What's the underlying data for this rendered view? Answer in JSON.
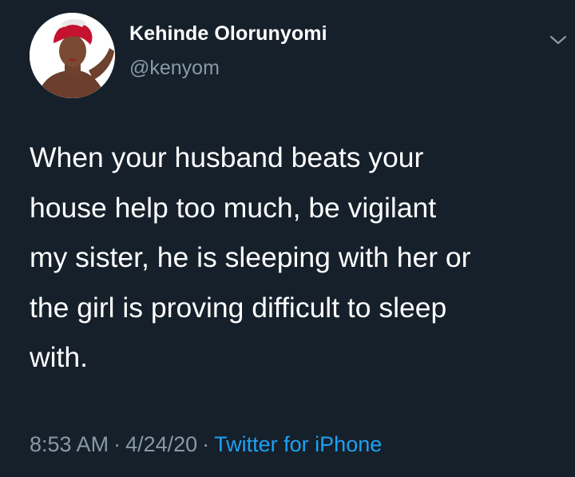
{
  "author": {
    "name": "Kehinde Olorunyomi",
    "handle": "@kenyom"
  },
  "tweet": {
    "lines": [
      "When your husband beats your",
      "house help too much, be vigilant",
      "my sister, he is sleeping with her or",
      "the girl is proving difficult to sleep",
      "with."
    ]
  },
  "meta": {
    "time": "8:53 AM",
    "separator": "·",
    "date": "4/24/20",
    "source": "Twitter for iPhone"
  },
  "icons": {
    "menu": "chevron-down-icon"
  },
  "colors": {
    "background": "#15202b",
    "primary_text": "#ffffff",
    "secondary_text": "#8899a6",
    "link": "#1da1f2"
  }
}
